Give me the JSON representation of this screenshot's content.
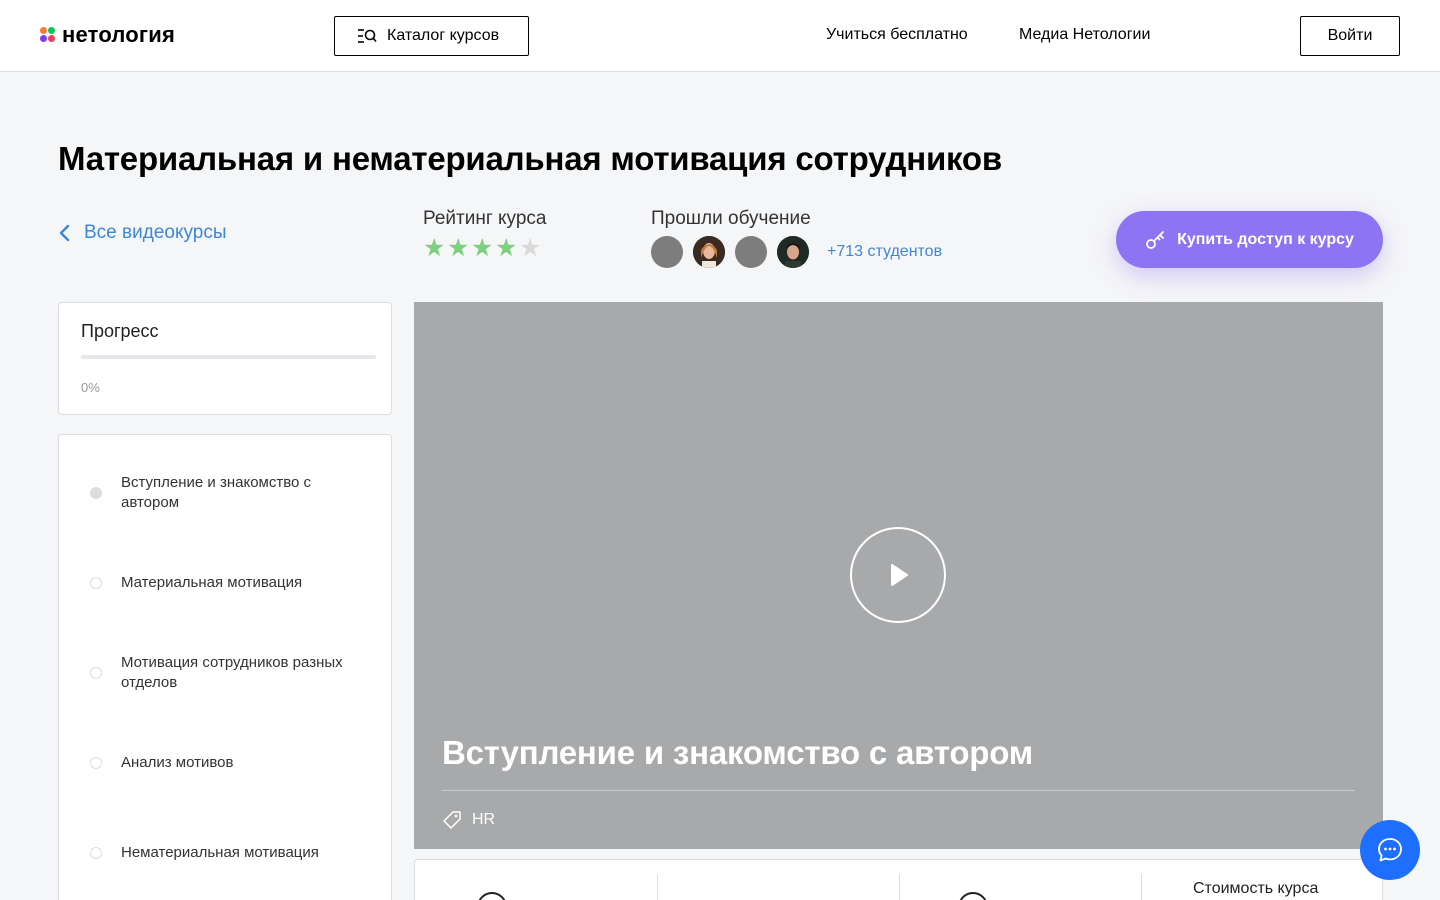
{
  "header": {
    "logo_text": "нетология",
    "catalog_label": "Каталог курсов",
    "nav": [
      "Учиться бесплатно",
      "Медиа Нетологии"
    ],
    "login_label": "Войти"
  },
  "course": {
    "title": "Материальная и нематериальная мотивация сотрудников",
    "back_label": "Все видеокурсы",
    "rating_label": "Рейтинг курса",
    "rating_value": 4,
    "rating_max": 5,
    "students_label": "Прошли обучение",
    "students_count": "+713 студентов",
    "buy_label": "Купить доступ к курсу"
  },
  "progress": {
    "title": "Прогресс",
    "percent_text": "0%",
    "fraction": 0
  },
  "lessons": [
    {
      "title": "Вступление и знакомство с автором",
      "active": true
    },
    {
      "title": "Материальная мотивация",
      "active": false
    },
    {
      "title": "Мотивация сотрудников разных отделов",
      "active": false
    },
    {
      "title": "Анализ мотивов",
      "active": false
    },
    {
      "title": "Нематериальная мотивация",
      "active": false
    }
  ],
  "video": {
    "title": "Вступление и знакомство с автором",
    "tag": "HR"
  },
  "info": {
    "price_label": "Стоимость курса"
  },
  "colors": {
    "accent": "#8c74f2",
    "link": "#3e86d6",
    "star_filled": "#7ed07e",
    "star_empty": "#d9d9d9",
    "chat": "#1e6fff"
  },
  "icons": {
    "catalog": "catalog-search-icon",
    "back": "chevron-left-icon",
    "buy": "key-icon",
    "play": "play-icon",
    "tag": "tag-icon",
    "chat": "chat-bubble-icon"
  }
}
